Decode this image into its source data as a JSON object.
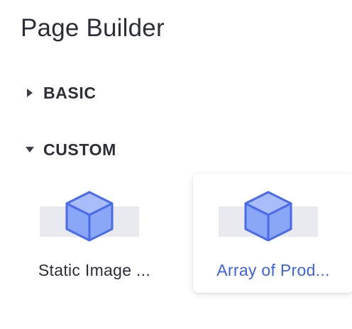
{
  "title": "Page Builder",
  "sections": [
    {
      "label": "BASIC",
      "expanded": false
    },
    {
      "label": "CUSTOM",
      "expanded": true
    }
  ],
  "custom_components": [
    {
      "label": "Static Image ...",
      "icon": "cube-icon",
      "selected": false
    },
    {
      "label": "Array of Prod...",
      "icon": "cube-icon",
      "selected": true
    }
  ],
  "colors": {
    "text": "#2b2f38",
    "accent": "#3b63e6",
    "cube_fill": "#8aa6f7",
    "cube_stroke": "#4a6bea",
    "preview_bar": "#e9eaf0"
  }
}
